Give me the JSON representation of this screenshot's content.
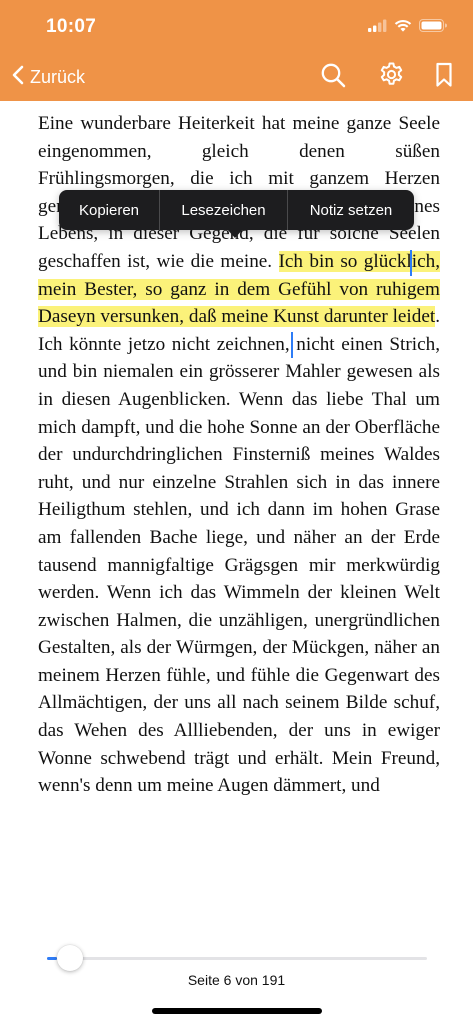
{
  "status_bar": {
    "time": "10:07"
  },
  "nav": {
    "back_label": "Zurück",
    "icons": [
      "search-icon",
      "gear-icon",
      "bookmark-icon"
    ]
  },
  "colors": {
    "header": "#ef9347",
    "highlight": "#fbf27a",
    "accent": "#2f7cf6",
    "popover": "#1d1d1f"
  },
  "popover": {
    "items": [
      "Kopieren",
      "Lesezeichen",
      "Notiz setzen"
    ]
  },
  "content": {
    "text_before": "Eine wunderbare Heiterkeit hat meine ganze Seele eingenommen, gleich denen süßen Frühlingsmorgen, die ich mit ganzem Herzen genieße. Ich bin allein und freue mich so meines Lebens, in dieser Gegend, die für sol­che Seelen geschaffen ist, wie die meine. ",
    "highlighted_text": "Ich bin so glücklich, mein Bester, so ganz in dem Gefühl von ruhigem Daseyn versunken, daß meine Kunst darunter leidet",
    "text_after": ". Ich könnte jet­zo nicht zeichnen, nicht einen Strich, und bin niemalen ein grösserer Mahler gewesen als in diesen Augenblicken. Wenn das liebe Thal um mich dampft, und die hohe Sonne an der Oberfläche der undurchdringlichen Finsterniß meines Waldes ruht, und nur ein­zelne Strahlen sich in das innere Heiligthum stehlen, und ich dann im hohen Grase am fallenden Bache liege, und näher an der Erde tausend mannigfaltige Grägsgen mir merk­würdig werden. Wenn ich das Wimmeln der kleinen Welt zwischen Halmen, die unzähli­gen, unergründlichen Gestalten, als der Würmgen, der Mückgen, näher an meinem Herzen fühle, und fühle die Gegenwart des Allmächtigen, der uns all nach seinem Bilde schuf, das Wehen des Allliebenden, der uns in ewiger Wonne schwebend trägt und erhält. Mein Freund, wenn's denn um meine Augen dämmert, und"
  },
  "reader": {
    "current_page": 6,
    "total_pages": 191,
    "page_label": "Seite 6 von 191"
  }
}
